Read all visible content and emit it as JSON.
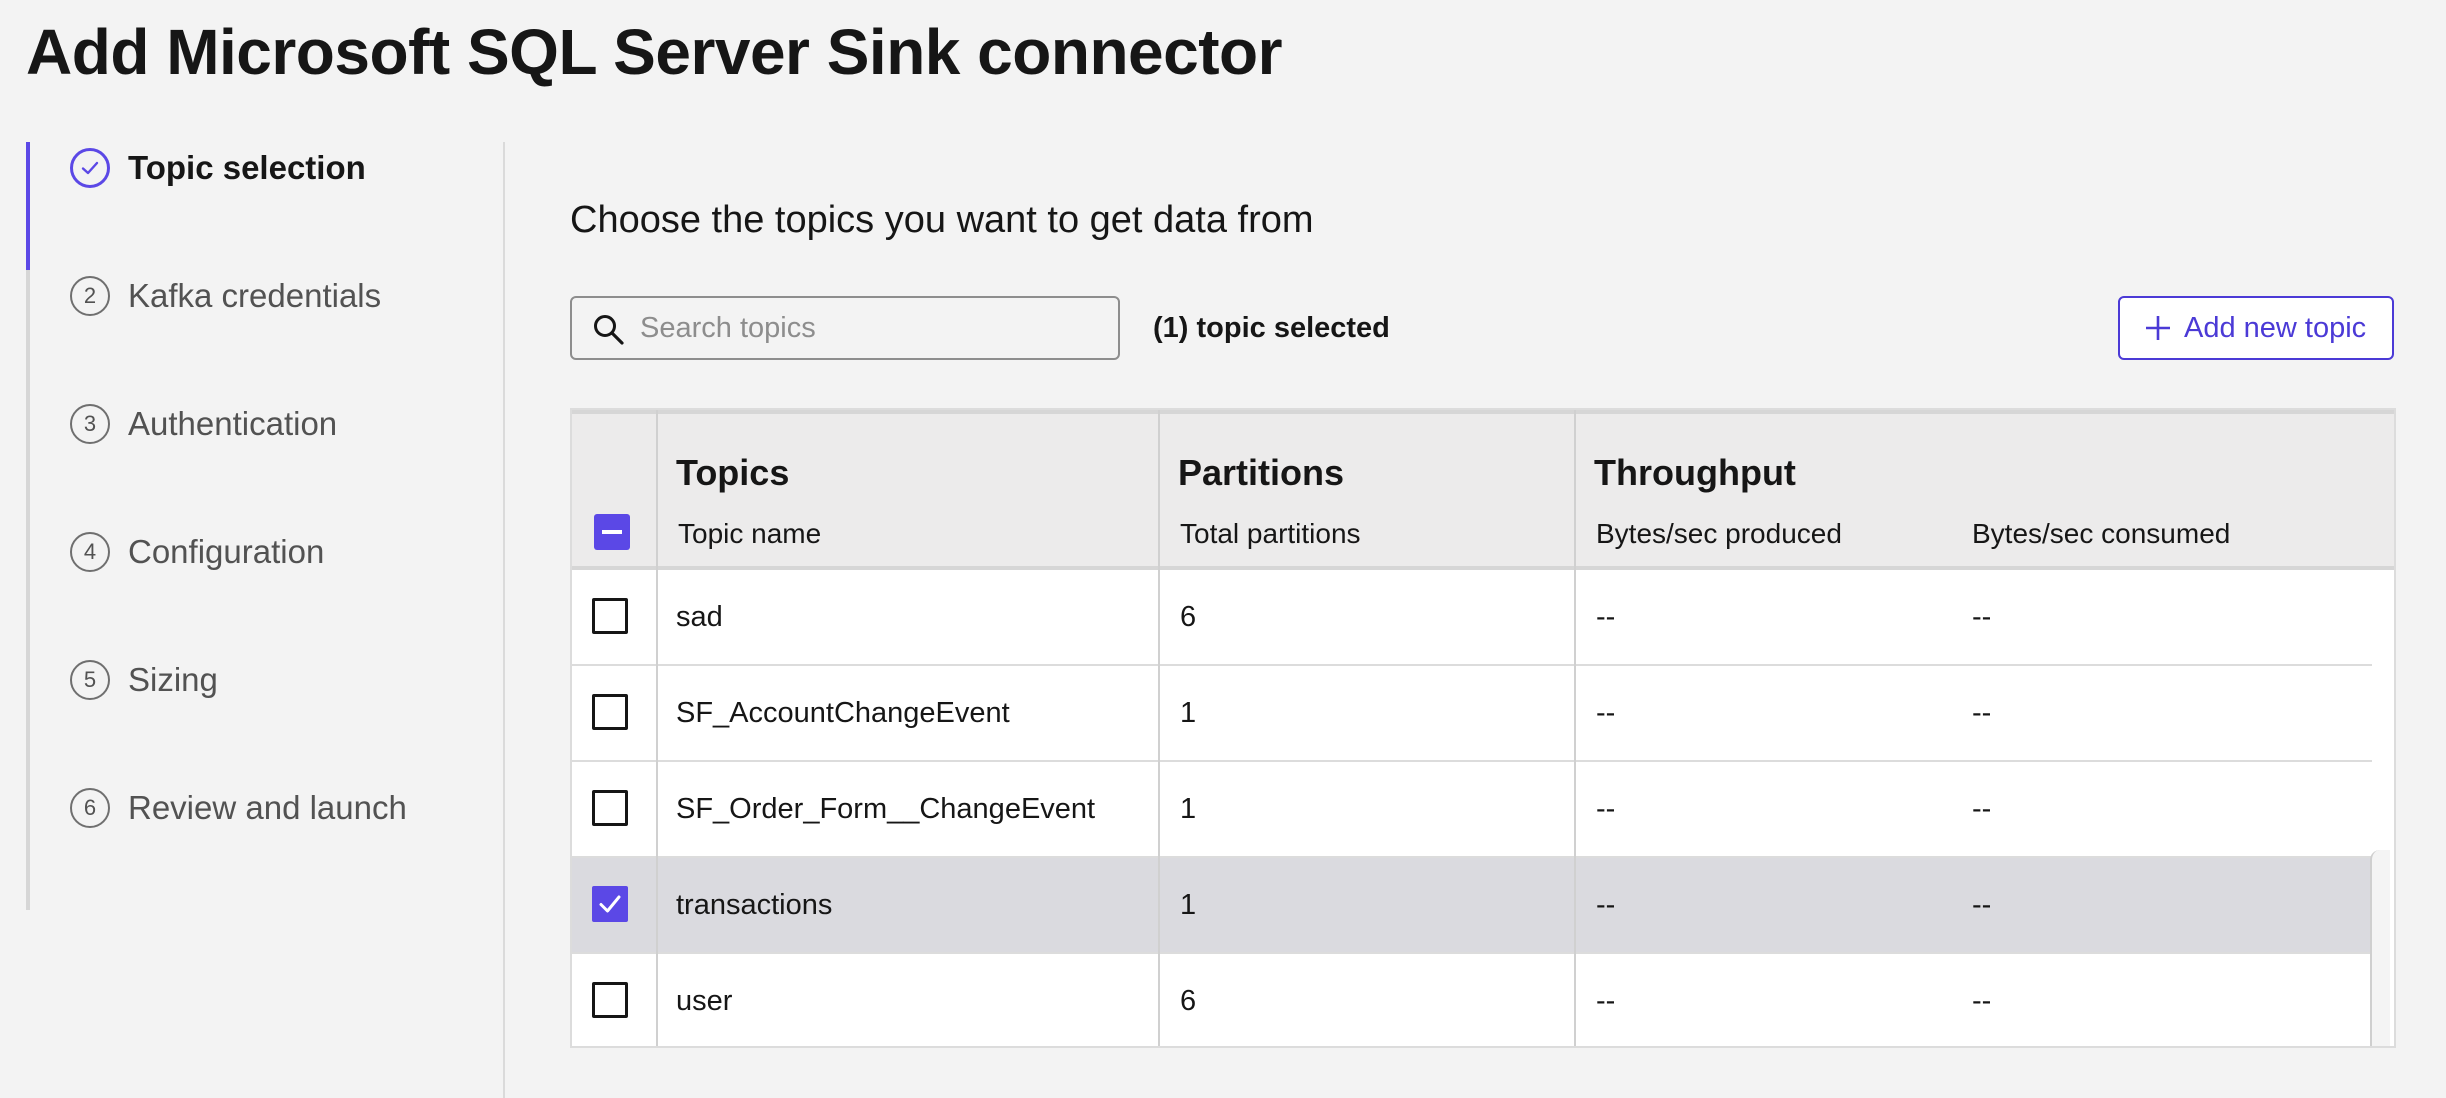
{
  "page": {
    "title": "Add Microsoft SQL Server Sink connector"
  },
  "stepper": {
    "steps": [
      {
        "number": "1",
        "label": "Topic selection",
        "status": "completed"
      },
      {
        "number": "2",
        "label": "Kafka credentials",
        "status": "pending"
      },
      {
        "number": "3",
        "label": "Authentication",
        "status": "pending"
      },
      {
        "number": "4",
        "label": "Configuration",
        "status": "pending"
      },
      {
        "number": "5",
        "label": "Sizing",
        "status": "pending"
      },
      {
        "number": "6",
        "label": "Review and launch",
        "status": "pending"
      }
    ]
  },
  "main": {
    "heading": "Choose the topics you want to get data from",
    "search": {
      "placeholder": "Search topics",
      "value": ""
    },
    "selected_count": "(1) topic selected",
    "add_topic_label": "Add new topic"
  },
  "table": {
    "groups": {
      "topics": "Topics",
      "partitions": "Partitions",
      "throughput": "Throughput"
    },
    "columns": {
      "topic_name": "Topic name",
      "total_partitions": "Total partitions",
      "bytes_produced": "Bytes/sec produced",
      "bytes_consumed": "Bytes/sec consumed"
    },
    "rows": [
      {
        "name": "sad",
        "partitions": "6",
        "produced": "--",
        "consumed": "--",
        "checked": false
      },
      {
        "name": "SF_AccountChangeEvent",
        "partitions": "1",
        "produced": "--",
        "consumed": "--",
        "checked": false
      },
      {
        "name": "SF_Order_Form__ChangeEvent",
        "partitions": "1",
        "produced": "--",
        "consumed": "--",
        "checked": false
      },
      {
        "name": "transactions",
        "partitions": "1",
        "produced": "--",
        "consumed": "--",
        "checked": true
      },
      {
        "name": "user",
        "partitions": "6",
        "produced": "--",
        "consumed": "--",
        "checked": false
      }
    ]
  },
  "colors": {
    "accent": "#5b48e6",
    "button_text": "#4b3ad6",
    "selected_row": "#dadadf"
  }
}
